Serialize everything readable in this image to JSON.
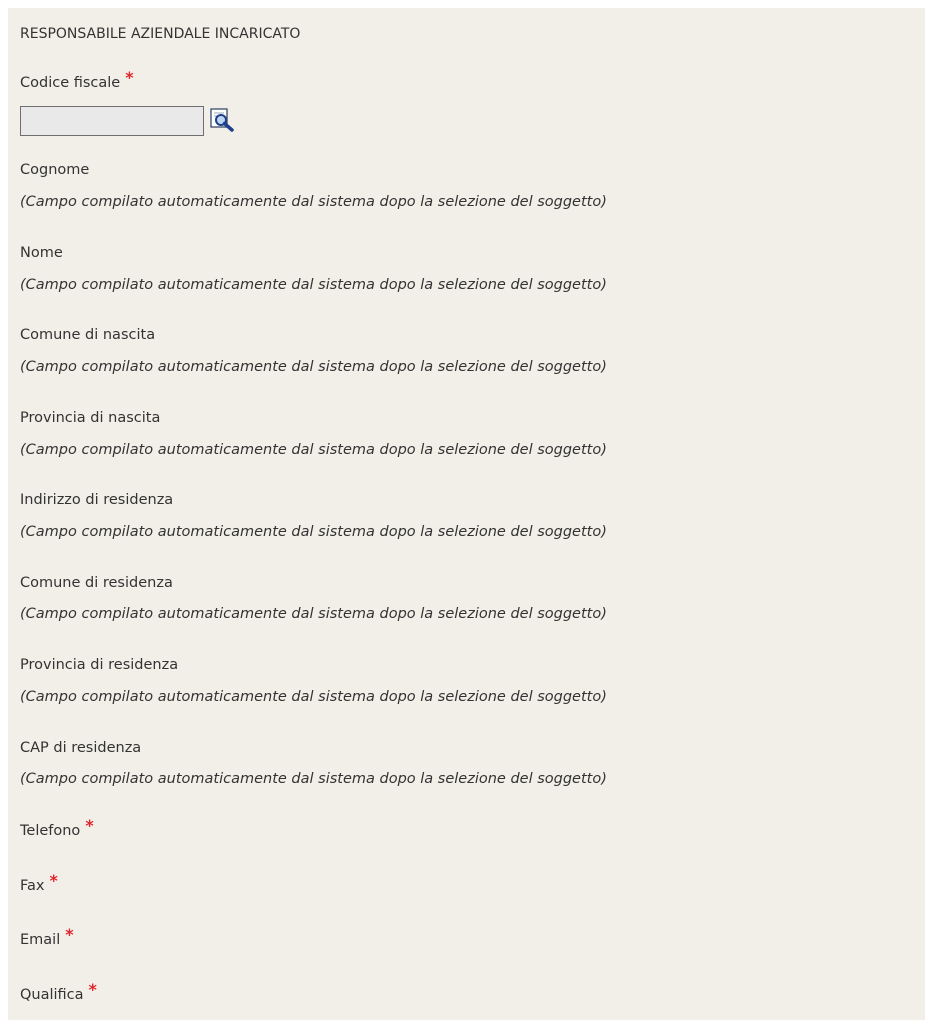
{
  "section": {
    "title": "RESPONSABILE AZIENDALE INCARICATO"
  },
  "codice_fiscale": {
    "label": "Codice fiscale",
    "required_mark": "*",
    "value": "",
    "placeholder": ""
  },
  "auto_fields": [
    {
      "label": "Cognome",
      "note": "(Campo compilato automaticamente dal sistema dopo la selezione del soggetto)"
    },
    {
      "label": "Nome",
      "note": "(Campo compilato automaticamente dal sistema dopo la selezione del soggetto)"
    },
    {
      "label": "Comune di nascita",
      "note": "(Campo compilato automaticamente dal sistema dopo la selezione del soggetto)"
    },
    {
      "label": "Provincia di nascita",
      "note": "(Campo compilato automaticamente dal sistema dopo la selezione del soggetto)"
    },
    {
      "label": "Indirizzo di residenza",
      "note": "(Campo compilato automaticamente dal sistema dopo la selezione del soggetto)"
    },
    {
      "label": "Comune di residenza",
      "note": "(Campo compilato automaticamente dal sistema dopo la selezione del soggetto)"
    },
    {
      "label": "Provincia di residenza",
      "note": "(Campo compilato automaticamente dal sistema dopo la selezione del soggetto)"
    },
    {
      "label": "CAP di residenza",
      "note": "(Campo compilato automaticamente dal sistema dopo la selezione del soggetto)"
    }
  ],
  "required_fields": [
    {
      "label": "Telefono",
      "required_mark": "*"
    },
    {
      "label": "Fax",
      "required_mark": "*"
    },
    {
      "label": "Email",
      "required_mark": "*"
    },
    {
      "label": "Qualifica",
      "required_mark": "*"
    }
  ],
  "icons": {
    "search": "search-icon"
  },
  "colors": {
    "panel_background": "#f2efe8",
    "required_asterisk": "#e0262b",
    "text": "#333333"
  }
}
